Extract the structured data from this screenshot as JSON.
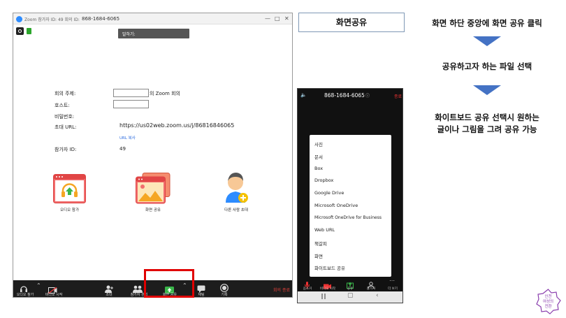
{
  "zoom": {
    "title": "Zoom 참가자 ID: 49   회의 ID:",
    "meeting_id": "868-1684-6065",
    "speaking_tip": "말하기:",
    "info": {
      "topic_label": "회의 주제:",
      "topic_suffix": "의 Zoom 회의",
      "host_label": "호스트:",
      "password_label": "비밀번호:",
      "invite_label": "초대 URL:",
      "invite_url": "https://us02web.zoom.us/j/86816846065",
      "copy_url": "URL 복사",
      "participant_label": "참가자 ID:",
      "participant_value": "49"
    },
    "tiles": {
      "audio": "오디오 참가",
      "share": "화면 공유",
      "invite": "다른 사람 초대"
    },
    "toolbar": {
      "join_audio": "오디오 참가",
      "video": "비디오 시작",
      "invite": "초대",
      "participants": "참가자 관리",
      "share": "화면 공유",
      "chat": "채팅",
      "record": "기록",
      "end": "회의 종료"
    }
  },
  "instructions": {
    "heading": "화면공유",
    "step1": "화면 하단 중앙에 화면 공유 클릭",
    "step2": "공유하고자 하는 파일 선택",
    "step3_line1": "화이트보드 공유 선택시 원하는",
    "step3_line2": "글이나 그림을 그려 공유 가능",
    "arrow_color": "#4472c4"
  },
  "phone": {
    "meeting_id": "868-1684-6065",
    "end_label": "종료",
    "menu": [
      "사진",
      "문서",
      "Box",
      "Dropbox",
      "Google Drive",
      "Microsoft OneDrive",
      "Microsoft OneDrive for Business",
      "Web URL",
      "책갈피",
      "화면",
      "화이트보드 공유"
    ],
    "toolbar": [
      "음소거",
      "비디오 시작",
      "공유",
      "참가자",
      "더 보기"
    ]
  },
  "stamp": {
    "line1": "인천",
    "line2": "여성의",
    "line3": "전환"
  }
}
